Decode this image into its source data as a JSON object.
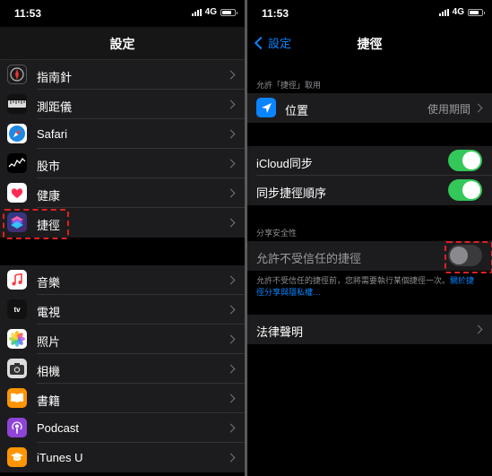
{
  "status": {
    "time": "11:53",
    "network": "4G"
  },
  "left": {
    "title": "設定",
    "items_group1": [
      {
        "label": "指南針",
        "icon": "compass-icon"
      },
      {
        "label": "測距儀",
        "icon": "measure-icon"
      },
      {
        "label": "Safari",
        "icon": "safari-icon"
      },
      {
        "label": "股市",
        "icon": "stocks-icon"
      },
      {
        "label": "健康",
        "icon": "health-icon"
      },
      {
        "label": "捷徑",
        "icon": "shortcuts-icon",
        "highlighted": true
      }
    ],
    "items_group2": [
      {
        "label": "音樂",
        "icon": "music-icon"
      },
      {
        "label": "電視",
        "icon": "tv-icon"
      },
      {
        "label": "照片",
        "icon": "photos-icon"
      },
      {
        "label": "相機",
        "icon": "camera-icon"
      },
      {
        "label": "書籍",
        "icon": "books-icon"
      },
      {
        "label": "Podcast",
        "icon": "podcast-icon"
      },
      {
        "label": "iTunes U",
        "icon": "itunes-u-icon"
      }
    ]
  },
  "right": {
    "back_label": "設定",
    "title": "捷徑",
    "section_access": "允許「捷徑」取用",
    "location": {
      "label": "位置",
      "value": "使用期間"
    },
    "icloud_sync": {
      "label": "iCloud同步",
      "on": true
    },
    "sync_order": {
      "label": "同步捷徑順序",
      "on": true
    },
    "section_security": "分享安全性",
    "untrusted": {
      "label": "允許不受信任的捷徑",
      "on": false
    },
    "footnote_text": "允許不受信任的捷徑前，您將需要執行某個捷徑一次。",
    "footnote_link": "關於捷徑分享與隱私權…",
    "legal": "法律聲明"
  },
  "colors": {
    "accent": "#0a84ff",
    "toggle_on": "#34c759",
    "highlight": "#e02020"
  }
}
